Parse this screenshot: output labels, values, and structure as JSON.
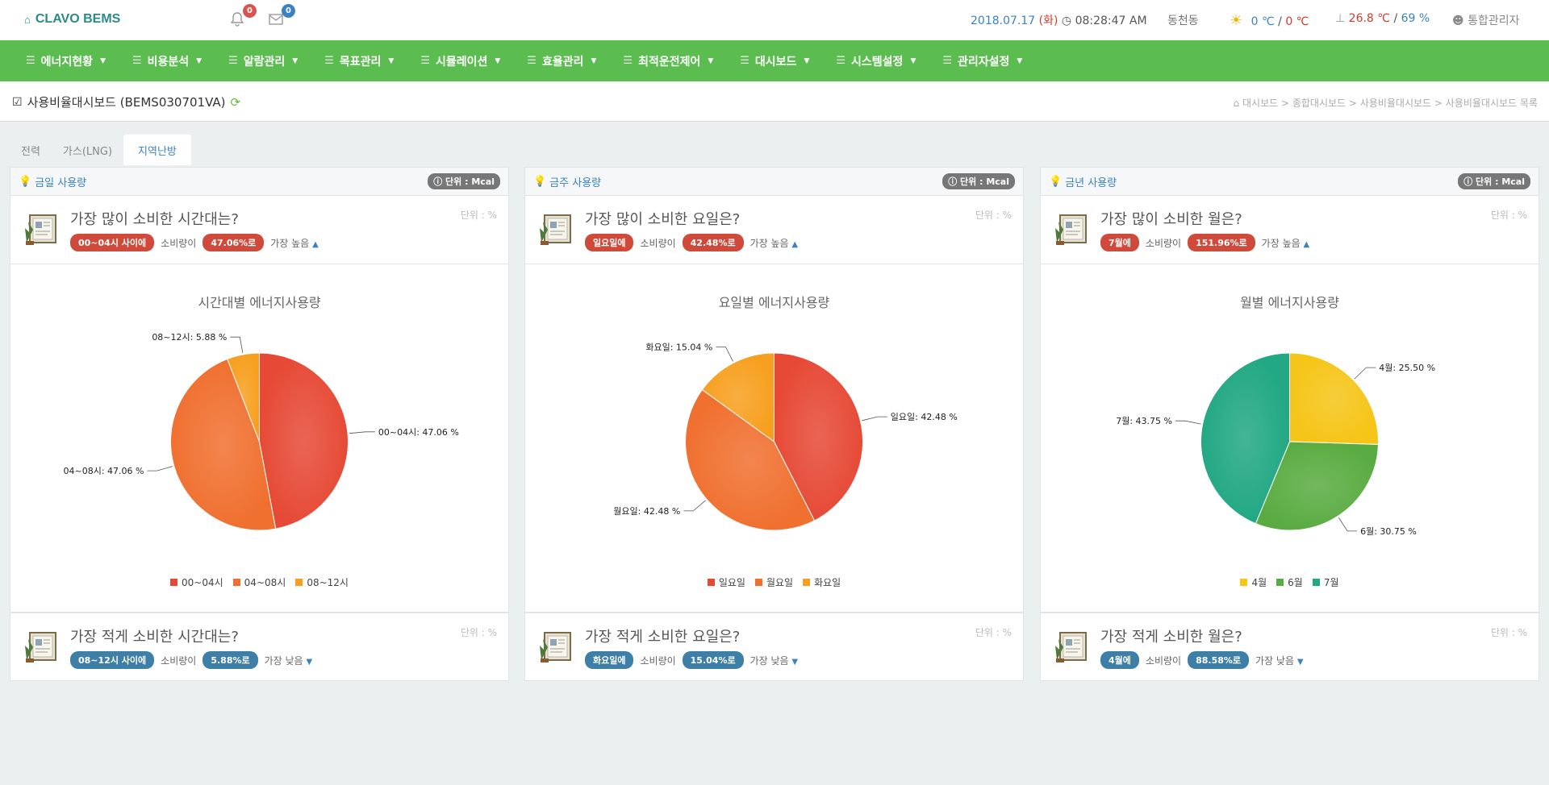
{
  "header": {
    "logo": "CLAVO BEMS",
    "alarm_count": "0",
    "mail_count": "0",
    "date": "2018.07.17",
    "day": "(화)",
    "time": "08:28:47 AM",
    "location": "동천동",
    "outside_temp_a": "0 ℃",
    "temp_sep": " / ",
    "outside_temp_b": "0 ℃",
    "inside_temp": "26.8 ℃",
    "humidity_sep": " / ",
    "humidity": "69 %",
    "user": "통합관리자"
  },
  "nav": [
    "에너지현황",
    "비용분석",
    "알람관리",
    "목표관리",
    "시뮬레이션",
    "효율관리",
    "최적운전제어",
    "대시보드",
    "시스템설정",
    "관리자설정"
  ],
  "page": {
    "title": "사용비율대시보드 (BEMS030701VA)",
    "breadcrumb": "대시보드 > 종합대시보드 > 사용비율대시보드 > 사용비율대시보드 목록"
  },
  "tabs": [
    "전력",
    "가스(LNG)",
    "지역난방"
  ],
  "panels": [
    {
      "title": "금일 사용량",
      "unit": "단위 : Mcal",
      "top": {
        "question": "가장 많이 소비한 시간대는?",
        "unit": "단위 : %",
        "pill1": "00~04시 사이에",
        "mid": "소비량이",
        "pill2": "47.06%로",
        "tail": "가장 높음"
      },
      "bottom": {
        "question": "가장 적게 소비한 시간대는?",
        "unit": "단위 : %",
        "pill1": "08~12시 사이에",
        "mid": "소비량이",
        "pill2": "5.88%로",
        "tail": "가장 낮음"
      }
    },
    {
      "title": "금주 사용량",
      "unit": "단위 : Mcal",
      "top": {
        "question": "가장 많이 소비한 요일은?",
        "unit": "단위 : %",
        "pill1": "일요일에",
        "mid": "소비량이",
        "pill2": "42.48%로",
        "tail": "가장 높음"
      },
      "bottom": {
        "question": "가장 적게 소비한 요일은?",
        "unit": "단위 : %",
        "pill1": "화요일에",
        "mid": "소비량이",
        "pill2": "15.04%로",
        "tail": "가장 낮음"
      }
    },
    {
      "title": "금년 사용량",
      "unit": "단위 : Mcal",
      "top": {
        "question": "가장 많이 소비한 월은?",
        "unit": "단위 : %",
        "pill1": "7월에",
        "mid": "소비량이",
        "pill2": "151.96%로",
        "tail": "가장 높음"
      },
      "bottom": {
        "question": "가장 적게 소비한 월은?",
        "unit": "단위 : %",
        "pill1": "4월에",
        "mid": "소비량이",
        "pill2": "88.58%로",
        "tail": "가장 낮음"
      }
    }
  ],
  "colors": {
    "accent_green": "#5bbd4f",
    "link_blue": "#3a82c4",
    "high_red": "#cf4a3a",
    "low_blue": "#3e7fa8"
  },
  "chart_data": [
    {
      "type": "pie",
      "title": "시간대별 에너지사용량",
      "slices": [
        {
          "name": "00~04시",
          "value": 47.06,
          "color": "#e64a36",
          "label": "00~04시: 47.06 %"
        },
        {
          "name": "04~08시",
          "value": 47.06,
          "color": "#f07030",
          "label": "04~08시: 47.06 %"
        },
        {
          "name": "08~12시",
          "value": 5.88,
          "color": "#f7a020",
          "label": "08~12시: 5.88 %"
        }
      ],
      "legend": "bottom"
    },
    {
      "type": "pie",
      "title": "요일별 에너지사용량",
      "slices": [
        {
          "name": "일요일",
          "value": 42.48,
          "color": "#e64a36",
          "label": "일요일: 42.48 %"
        },
        {
          "name": "월요일",
          "value": 42.48,
          "color": "#f07030",
          "label": "월요일: 42.48 %"
        },
        {
          "name": "화요일",
          "value": 15.04,
          "color": "#f7a020",
          "label": "화요일: 15.04 %"
        }
      ],
      "legend": "bottom"
    },
    {
      "type": "pie",
      "title": "월별 에너지사용량",
      "slices": [
        {
          "name": "4월",
          "value": 25.5,
          "color": "#f5c518",
          "label": "4월: 25.50 %"
        },
        {
          "name": "6월",
          "value": 30.75,
          "color": "#5aac42",
          "label": "6월: 30.75 %"
        },
        {
          "name": "7월",
          "value": 43.75,
          "color": "#22a884",
          "label": "7월: 43.75 %"
        }
      ],
      "legend": "bottom"
    }
  ]
}
